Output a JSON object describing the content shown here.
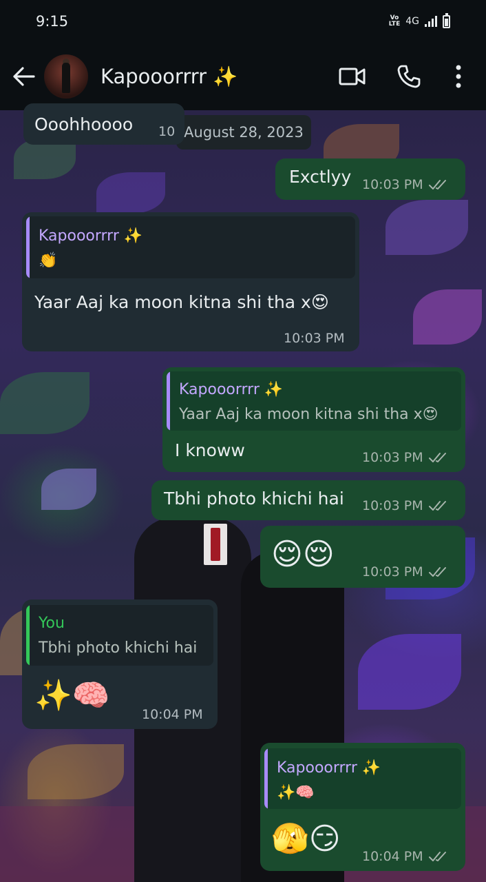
{
  "status_bar": {
    "time": "9:15",
    "network_volte": "Vo LTE",
    "network_type": "4G"
  },
  "header": {
    "contact_name": "Kapooorrrr ✨"
  },
  "date_chip": "August 28, 2023",
  "messages": [
    {
      "id": "m0",
      "direction": "in",
      "text": "Ooohhoooo",
      "time": "10"
    },
    {
      "id": "m1",
      "direction": "out",
      "text": "Exctlyy",
      "time": "10:03 PM"
    },
    {
      "id": "m2",
      "direction": "in",
      "quote_author": "Kapooorrrr ✨",
      "quote_text": "👏",
      "text": "Yaar Aaj ka moon kitna shi tha x😍",
      "time": "10:03 PM"
    },
    {
      "id": "m3",
      "direction": "out",
      "quote_author": "Kapooorrrr ✨",
      "quote_text": "Yaar Aaj ka moon kitna shi tha x😍",
      "text": "I knoww",
      "time": "10:03 PM"
    },
    {
      "id": "m4",
      "direction": "out",
      "text": "Tbhi photo khichi hai",
      "time": "10:03 PM"
    },
    {
      "id": "m5",
      "direction": "out",
      "text": "😌😌",
      "time": "10:03 PM"
    },
    {
      "id": "m6",
      "direction": "in",
      "quote_author": "You",
      "quote_text": "Tbhi photo khichi hai",
      "text": "✨🧠",
      "time": "10:04 PM"
    },
    {
      "id": "m7",
      "direction": "out",
      "quote_author": "Kapooorrrr ✨",
      "quote_text": "✨🧠",
      "text": "🫣😏",
      "time": "10:04 PM"
    }
  ],
  "colors": {
    "incoming_bubble": "#202c33",
    "outgoing_bubble": "#1a4b2e",
    "quote_author_contact": "#a78bfa",
    "quote_author_you": "#34c759",
    "read_ticks": "#a8b5ad"
  },
  "icons": [
    "back-arrow-icon",
    "video-call-icon",
    "phone-icon",
    "more-vert-icon",
    "double-tick-icon"
  ]
}
